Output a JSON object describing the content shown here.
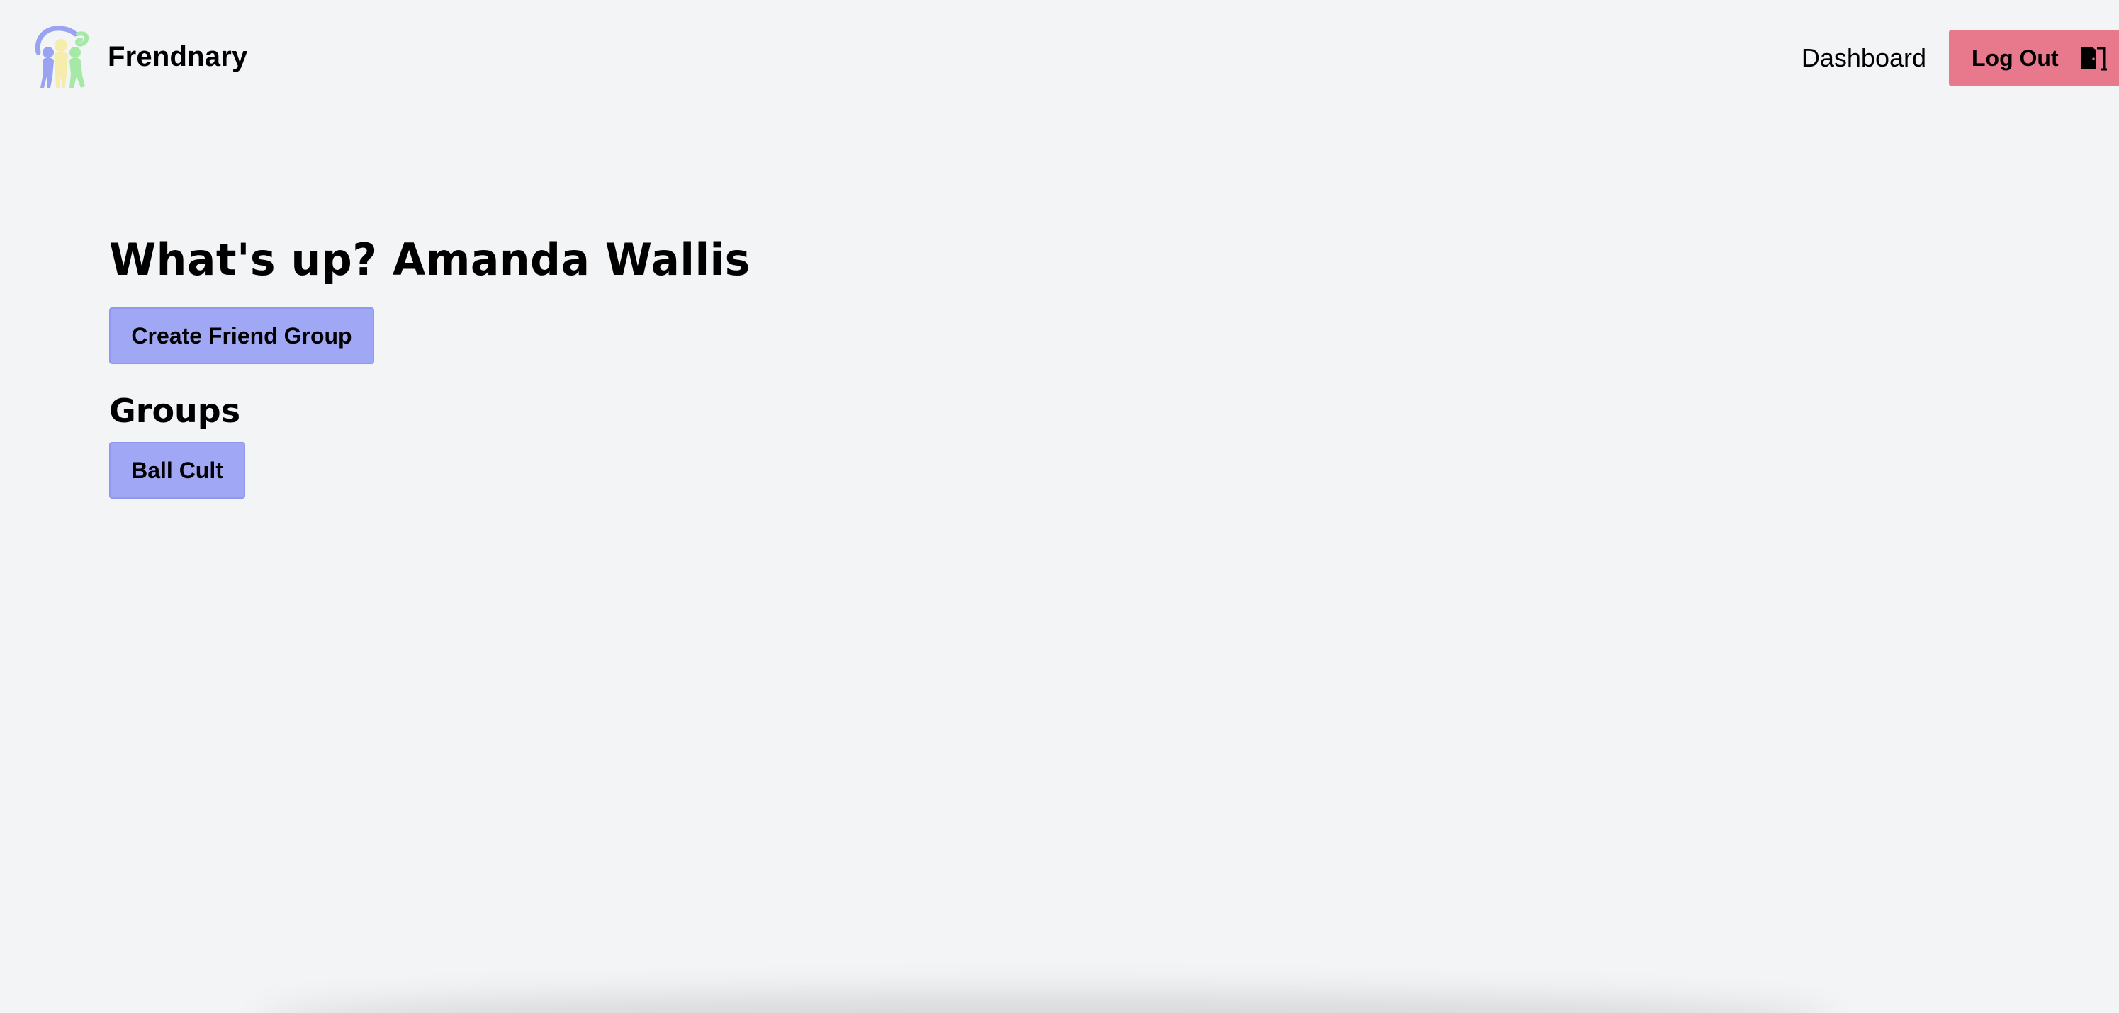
{
  "app": {
    "name": "Frendnary",
    "logo_icon": "three-friends-logo-icon"
  },
  "nav": {
    "dashboard_label": "Dashboard",
    "logout_label": "Log Out",
    "logout_icon": "door-exit-icon"
  },
  "main": {
    "greeting": "What's up? Amanda Wallis",
    "create_button_label": "Create Friend Group",
    "groups_heading": "Groups",
    "groups": [
      {
        "label": "Ball Cult"
      }
    ]
  },
  "colors": {
    "background": "#f3f4f6",
    "primary_button": "#a0a8f5",
    "logout_button": "#e8788b",
    "logo_blue": "#9aa3f2",
    "logo_yellow": "#f6ecab",
    "logo_green": "#a6e9a7"
  }
}
